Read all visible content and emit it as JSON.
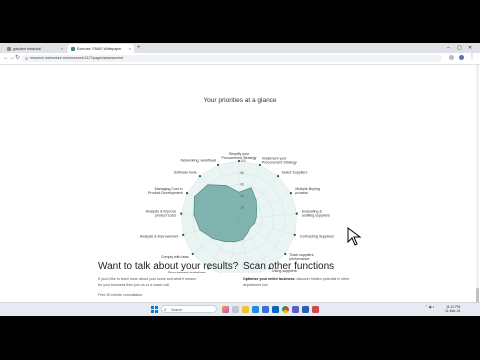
{
  "browser": {
    "tabs": [
      {
        "label": "gasoline electrical",
        "active": false
      },
      {
        "label": "Exercise: FBAIS Whitepaper",
        "active": true
      }
    ],
    "new_tab": "+",
    "url": "resource.instructure.com/courses/1317/pages/assessment"
  },
  "page": {
    "chart_title": "Your priorities at a glance",
    "talk": {
      "heading": "Want to talk about your results?",
      "line1": "If you'd like to learn more about your score and what it means",
      "line2": "for your business then join us or a coach call.",
      "line3": "Free 30 minute consultation"
    },
    "scan": {
      "heading": "Scan other functions",
      "bold": "Optimise your entire business",
      "line1": ": discover hidden potential in other",
      "line2": "department too!"
    }
  },
  "chart_data": {
    "type": "radar",
    "title": "Your priorities at a glance",
    "rlim": [
      0,
      100
    ],
    "ticks": [
      20,
      40,
      60,
      80,
      100
    ],
    "categories": [
      "Simplify your Procurement Strategy",
      "Implement your Procurement Strategy",
      "Select Suppliers",
      "Multiple Buying process",
      "Evaluating & auditing suppliers",
      "Contracting Suppliers",
      "Track suppliers performance",
      "Using suppliers to innovate",
      "Processing orders",
      "Managing risks",
      "Procurement guidelines",
      "Comply with laws",
      "Analysis & improvement",
      "Analysis & improve product costs",
      "Managing Cost in Product Development",
      "Software tools",
      "Networking, workflows"
    ],
    "values": [
      46,
      58,
      44,
      34,
      30,
      28,
      24,
      28,
      36,
      40,
      46,
      56,
      70,
      78,
      86,
      80,
      62
    ],
    "fill_color": "#5d9e98",
    "grid_color": "#cfe6e3"
  },
  "taskbar": {
    "search_placeholder": "Search",
    "time": "11:41 PM",
    "date": "11-Mar-24"
  }
}
